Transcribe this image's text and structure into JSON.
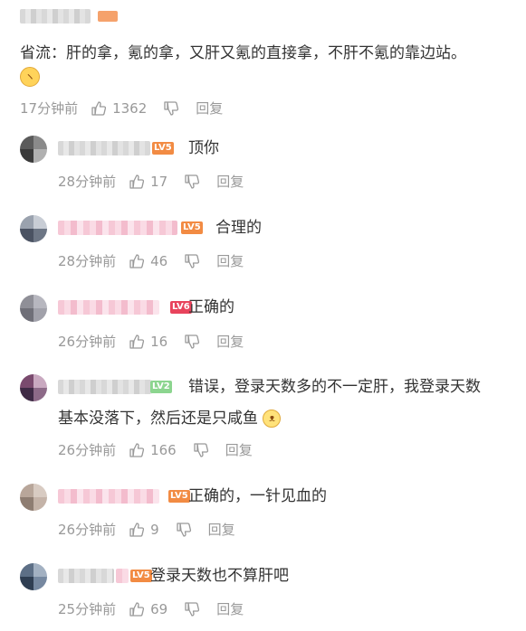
{
  "root": {
    "text": "省流：肝的拿，氪的拿，又肝又氪的直接拿，不肝不氪的靠边站。",
    "emoji": "sulky-face",
    "time": "17分钟前",
    "likes": "1362",
    "reply_label": "回复"
  },
  "replies": [
    {
      "level": "LV5",
      "text": "顶你",
      "time": "28分钟前",
      "likes": "17",
      "reply_label": "回复"
    },
    {
      "level": "LV5",
      "text": "合理的",
      "time": "28分钟前",
      "likes": "46",
      "reply_label": "回复"
    },
    {
      "level": "LV6",
      "text": "正确的",
      "time": "26分钟前",
      "likes": "16",
      "reply_label": "回复"
    },
    {
      "level": "LV2",
      "text_line1": "错误，登录天数多的不一定肝，我登录天数",
      "text_line2": "基本没落下，然后还是只咸鱼",
      "emoji": "cat-face",
      "time": "26分钟前",
      "likes": "166",
      "reply_label": "回复"
    },
    {
      "level": "LV5",
      "text": "正确的，一针见血的",
      "time": "26分钟前",
      "likes": "9",
      "reply_label": "回复"
    },
    {
      "level": "LV5",
      "text": "登录天数也不算肝吧",
      "time": "25分钟前",
      "likes": "69",
      "reply_label": "回复"
    }
  ],
  "colors": {
    "text": "#333333",
    "meta": "#999999",
    "lv5": "#f28b43",
    "lv6": "#e8435c",
    "lv2": "#8cd58f"
  }
}
